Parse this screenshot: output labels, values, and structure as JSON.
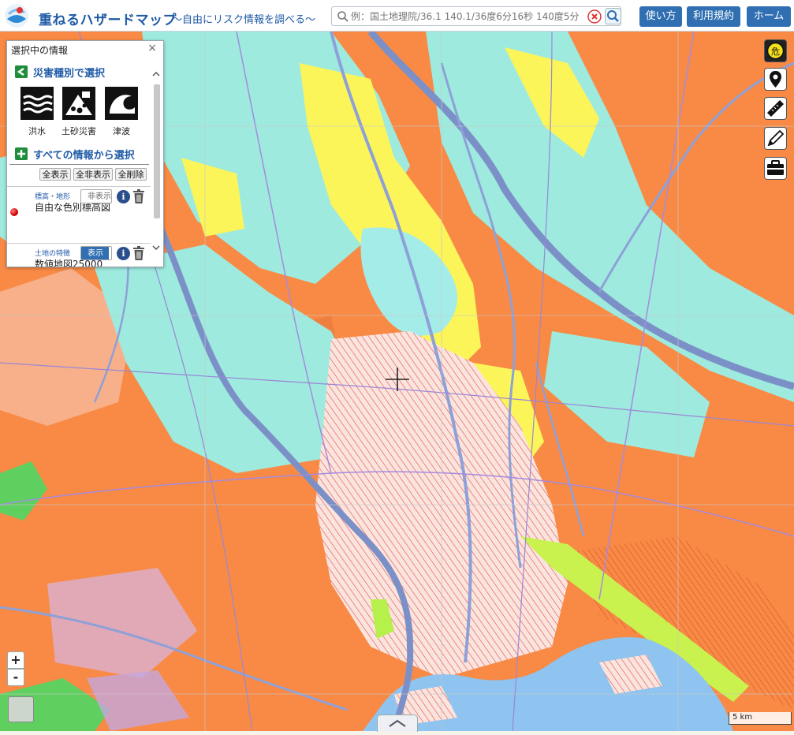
{
  "header": {
    "title": "重ねるハザードマップ",
    "subtitle": "～自由にリスク情報を調べる～",
    "search_placeholder": "例：国土地理院/36.1 140.1/36度6分16秒 140度5分",
    "buttons": {
      "usage": "使い方",
      "terms": "利用規約",
      "home": "ホーム"
    }
  },
  "panel": {
    "title": "選択中の情報",
    "close": "×",
    "section_hazard": "災害種別で選択",
    "hazards": [
      {
        "label": "洪水",
        "icon": "flood-icon"
      },
      {
        "label": "土砂災害",
        "icon": "landslide-icon"
      },
      {
        "label": "津波",
        "icon": "tsunami-icon"
      }
    ],
    "section_all": "すべての情報から選択",
    "actions": {
      "show_all": "全表示",
      "hide_all": "全非表示",
      "delete_all": "全削除"
    },
    "layers": [
      {
        "category": "標高・地形",
        "name": "自由な色別標高図",
        "toggle": "非表示",
        "visible": false
      },
      {
        "category": "土地の特徴",
        "name": "数値地図25000",
        "toggle": "表示",
        "visible": true
      }
    ]
  },
  "map": {
    "scale": "5 km",
    "zoom_in": "+",
    "zoom_out": "-",
    "colors": {
      "orange": "#f88a45",
      "cyan": "#9eeade",
      "yellow": "#fbf55a",
      "river": "#7c90c8",
      "water": "#8ec4ef",
      "urban": "#fbe2dc",
      "green": "#5fcf5f",
      "purple": "#a58ae0"
    }
  },
  "tools": [
    "hazard-icon",
    "pin-icon",
    "ruler-icon",
    "pencil-icon",
    "toolbox-icon"
  ]
}
